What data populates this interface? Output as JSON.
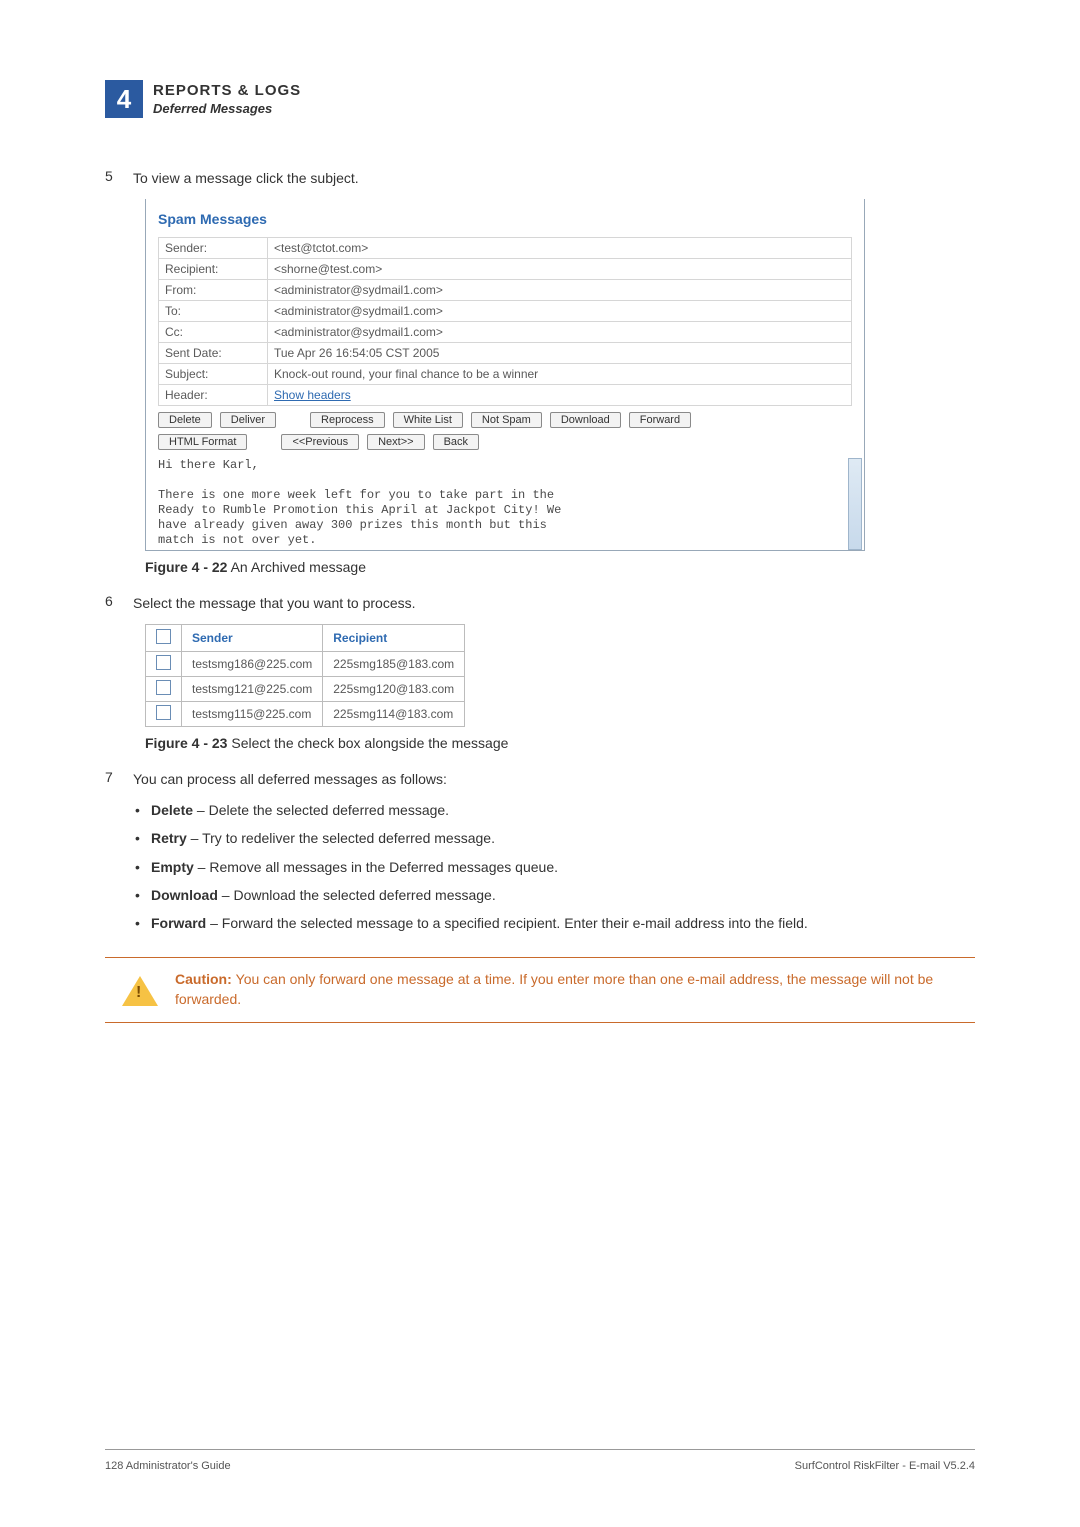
{
  "chapter": {
    "number": "4",
    "title": "REPORTS & LOGS",
    "subtitle": "Deferred Messages"
  },
  "step5": {
    "num": "5",
    "text": "To view a message click the subject."
  },
  "spam_panel": {
    "title": "Spam Messages",
    "rows": {
      "sender_label": "Sender:",
      "sender_val": "<test@tctot.com>",
      "recipient_label": "Recipient:",
      "recipient_val": "<shorne@test.com>",
      "from_label": "From:",
      "from_val": "<administrator@sydmail1.com>",
      "to_label": "To:",
      "to_val": "<administrator@sydmail1.com>",
      "cc_label": "Cc:",
      "cc_val": "<administrator@sydmail1.com>",
      "sent_label": "Sent Date:",
      "sent_val": "Tue Apr 26 16:54:05 CST 2005",
      "subject_label": "Subject:",
      "subject_val": "Knock-out round, your final chance to be a winner",
      "header_label": "Header:",
      "header_link": "Show headers"
    },
    "buttons1": {
      "delete": "Delete",
      "deliver": "Deliver",
      "reprocess": "Reprocess",
      "whitelist": "White List",
      "notspam": "Not Spam",
      "download": "Download",
      "forward": "Forward"
    },
    "buttons2": {
      "htmlformat": "HTML Format",
      "prev": "<<Previous",
      "next": "Next>>",
      "back": "Back"
    },
    "body_line1": "Hi there Karl,",
    "body_line2": "There is one more week left for you to take part in the",
    "body_line3": "Ready to Rumble Promotion this April at Jackpot City! We",
    "body_line4": "have already given away 300 prizes this month but this",
    "body_line5": "match is not over yet."
  },
  "fig22": {
    "label": "Figure 4 - 22",
    "text": " An Archived message"
  },
  "step6": {
    "num": "6",
    "text": "Select the message that you want to process."
  },
  "mini_table": {
    "hdr_sender": "Sender",
    "hdr_recipient": "Recipient",
    "rows": [
      {
        "s": "testsmg186@225.com",
        "r": "225smg185@183.com"
      },
      {
        "s": "testsmg121@225.com",
        "r": "225smg120@183.com"
      },
      {
        "s": "testsmg115@225.com",
        "r": "225smg114@183.com"
      }
    ]
  },
  "fig23": {
    "label": "Figure 4 - 23",
    "text": " Select the check box alongside the message"
  },
  "step7": {
    "num": "7",
    "text": "You can process all deferred messages as follows:",
    "bullets": {
      "delete_b": "Delete",
      "delete_t": " – Delete the selected deferred message.",
      "retry_b": "Retry",
      "retry_t": " – Try to redeliver the selected deferred message.",
      "empty_b": "Empty",
      "empty_t": " – Remove all messages in the Deferred messages queue.",
      "download_b": "Download",
      "download_t": " – Download the selected deferred message.",
      "forward_b": "Forward",
      "forward_t": " – Forward the selected message to a specified recipient. Enter their e-mail address into the field."
    }
  },
  "caution": {
    "label": "Caution:  ",
    "text": "You can only forward one message at a time. If you enter more than one e-mail address, the message will not be forwarded."
  },
  "footer": {
    "left": "128  Administrator's Guide",
    "right": "SurfControl RiskFilter - E-mail V5.2.4"
  }
}
